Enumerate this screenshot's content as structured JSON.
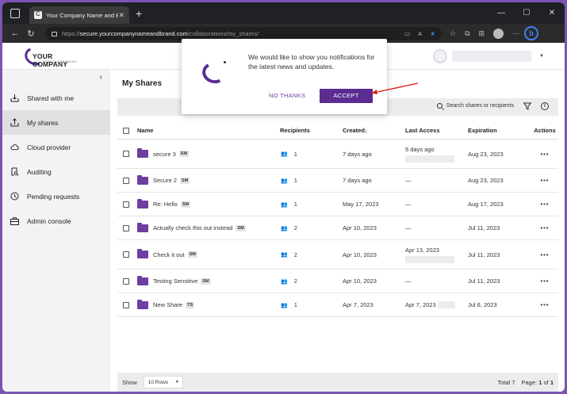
{
  "browser": {
    "tab_title": "Your Company Name and Brand",
    "url_scheme": "https://",
    "url_host": "secure.yourcompanynameandbrand.com",
    "url_path": "/collaborations/my_shares/"
  },
  "brand": {
    "name": "YOUR COMPANY",
    "tagline": "NAME AND BRANDING",
    "accent": "#5b2d91"
  },
  "popup": {
    "message": "We would like to show you notifications for the latest news and updates.",
    "no_thanks": "NO THANKS",
    "accept": "ACCEPT"
  },
  "sidebar": {
    "items": [
      {
        "label": "Shared with me",
        "icon": "inbox-download-icon"
      },
      {
        "label": "My shares",
        "icon": "upload-share-icon"
      },
      {
        "label": "Cloud provider",
        "icon": "cloud-icon"
      },
      {
        "label": "Auditing",
        "icon": "search-document-icon"
      },
      {
        "label": "Pending requests",
        "icon": "clock-icon"
      },
      {
        "label": "Admin console",
        "icon": "briefcase-icon"
      }
    ]
  },
  "main": {
    "title": "My Shares",
    "search_placeholder": "Search shares or recipients",
    "columns": [
      "Name",
      "Recipients",
      "Created",
      "Last Access",
      "Expiration",
      "Actions"
    ],
    "rows": [
      {
        "name": "secure 3",
        "badge": "SM",
        "recipients": "1",
        "created": "7 days ago",
        "last_access": "5 days ago",
        "expiration": "Aug 23, 2023"
      },
      {
        "name": "Secure 2",
        "badge": "SM",
        "recipients": "1",
        "created": "7 days ago",
        "last_access": "—",
        "expiration": "Aug 23, 2023"
      },
      {
        "name": "Re: Hello",
        "badge": "SM",
        "recipients": "1",
        "created": "May 17, 2023",
        "last_access": "—",
        "expiration": "Aug 17, 2023"
      },
      {
        "name": "Actually check this out instead",
        "badge": "SM",
        "recipients": "2",
        "created": "Apr 10, 2023",
        "last_access": "—",
        "expiration": "Jul 11, 2023"
      },
      {
        "name": "Check it out",
        "badge": "SM",
        "recipients": "2",
        "created": "Apr 10, 2023",
        "last_access": "Apr 13, 2023",
        "expiration": "Jul 11, 2023"
      },
      {
        "name": "Testing Sensitive",
        "badge": "SM",
        "recipients": "2",
        "created": "Apr 10, 2023",
        "last_access": "—",
        "expiration": "Jul 11, 2023"
      },
      {
        "name": "New Share",
        "badge": "TS",
        "recipients": "1",
        "created": "Apr 7, 2023",
        "last_access": "Apr 7, 2023",
        "expiration": "Jul 6, 2023"
      }
    ],
    "actions_glyph": "•••"
  },
  "footer": {
    "show_label": "Show",
    "rows_option": "10 Rows",
    "total": "Total 7",
    "page_label": "Page:",
    "page_current": "1",
    "page_of": "of",
    "page_total": "1"
  }
}
